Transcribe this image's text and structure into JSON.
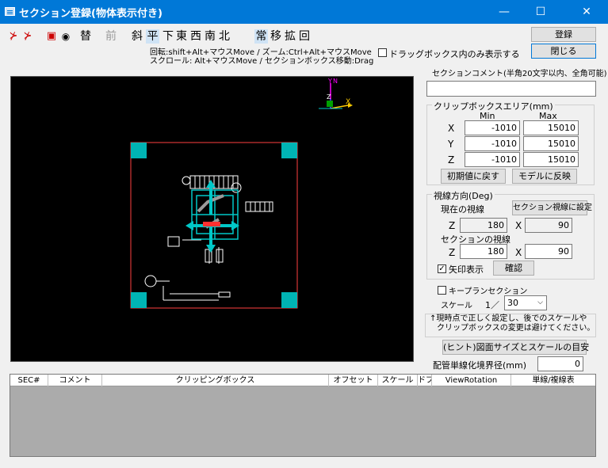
{
  "window": {
    "title": "セクション登録(物体表示付き)",
    "min_glyph": "—",
    "max_glyph": "☐",
    "close_glyph": "✕"
  },
  "toolbar": {
    "icons": [
      "⊁",
      "⊁",
      "▣",
      "◉"
    ],
    "views": [
      {
        "label": "替",
        "state": "normal"
      },
      {
        "label": "前",
        "state": "disabled"
      },
      {
        "label": "斜",
        "state": "normal"
      },
      {
        "label": "平",
        "state": "selected"
      },
      {
        "label": "下",
        "state": "normal"
      },
      {
        "label": "東",
        "state": "normal"
      },
      {
        "label": "西",
        "state": "normal"
      },
      {
        "label": "南",
        "state": "normal"
      },
      {
        "label": "北",
        "state": "normal"
      },
      {
        "label": "常",
        "state": "selected"
      },
      {
        "label": "移",
        "state": "normal"
      },
      {
        "label": "拡",
        "state": "normal"
      },
      {
        "label": "回",
        "state": "normal"
      }
    ]
  },
  "hints": {
    "line1": "回転:shift+Alt+マウスMove / ズーム:Ctrl+Alt+マウスMove",
    "line2": "スクロール: Alt+マウスMove / セクションボックス移動:Drag"
  },
  "drag_only": {
    "label": "ドラッグボックス内のみ表示する",
    "checked": false
  },
  "buttons": {
    "register": "登録",
    "close": "閉じる",
    "reset": "初期値に戻す",
    "apply_model": "モデルに反映",
    "set_section_view": "セクション視線に設定",
    "confirm": "確認",
    "hint_size": "(ヒント)図面サイズとスケールの目安"
  },
  "section_comment": {
    "label": "セクションコメント(半角20文字以内、全角可能)",
    "value": ""
  },
  "clip_box": {
    "title": "クリップボックスエリア(mm)",
    "min_label": "Min",
    "max_label": "Max",
    "rows": [
      {
        "axis": "X",
        "min": "-1010",
        "max": "15010"
      },
      {
        "axis": "Y",
        "min": "-1010",
        "max": "15010"
      },
      {
        "axis": "Z",
        "min": "-1010",
        "max": "15010"
      }
    ]
  },
  "view_dir": {
    "title": "視線方向(Deg)",
    "current_label": "現在の視線",
    "section_label": "セクションの視線",
    "current": {
      "z_label": "Z",
      "z": "180",
      "x_label": "X",
      "x": "90"
    },
    "section": {
      "z_label": "Z",
      "z": "180",
      "x_label": "X",
      "x": "90"
    },
    "arrow_label": "矢印表示",
    "arrow_checked": true
  },
  "keyplan": {
    "label": "キープランセクション",
    "checked": false
  },
  "scale": {
    "label": "スケール",
    "prefix": "1／",
    "value": "30"
  },
  "note": {
    "line1": "↑現時点で正しく設定し、後でのスケールや",
    "line2": "クリップボックスの変更は避けてください。"
  },
  "pipe_single": {
    "label": "配管単線化境界径(mm)",
    "value": "0"
  },
  "axes": {
    "x": "X",
    "y": "Y",
    "z": "Z",
    "n": "N"
  },
  "list": {
    "columns": [
      "SEC#",
      "コメント",
      "クリッピングボックス",
      "オフセット",
      "スケール",
      "ドブ",
      "ViewRotation",
      "単線/複線表"
    ]
  },
  "colors": {
    "titlebar": "#0078d7",
    "cyan": "#00c8c8",
    "red": "#ff3030"
  }
}
